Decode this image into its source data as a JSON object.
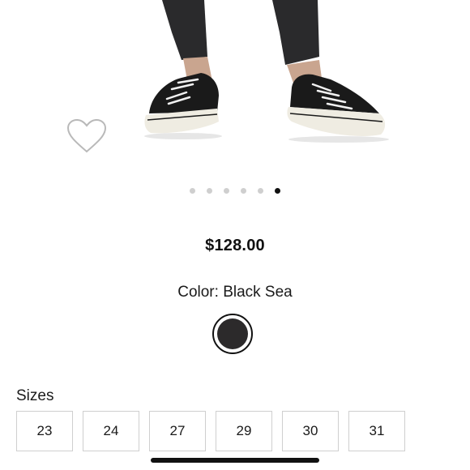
{
  "product": {
    "price": "$128.00",
    "color_line": "Color: Black Sea",
    "swatch_color": "#2c2a2b"
  },
  "gallery": {
    "image_count": 6,
    "active_index": 5,
    "wishlist_icon": "heart-outline-icon"
  },
  "sizes": {
    "label": "Sizes",
    "options": [
      "23",
      "24",
      "27",
      "29",
      "30",
      "31"
    ]
  },
  "colors": {
    "accent": "#111111",
    "border": "#cfcfcf",
    "dot_inactive": "#cfcfcf"
  }
}
